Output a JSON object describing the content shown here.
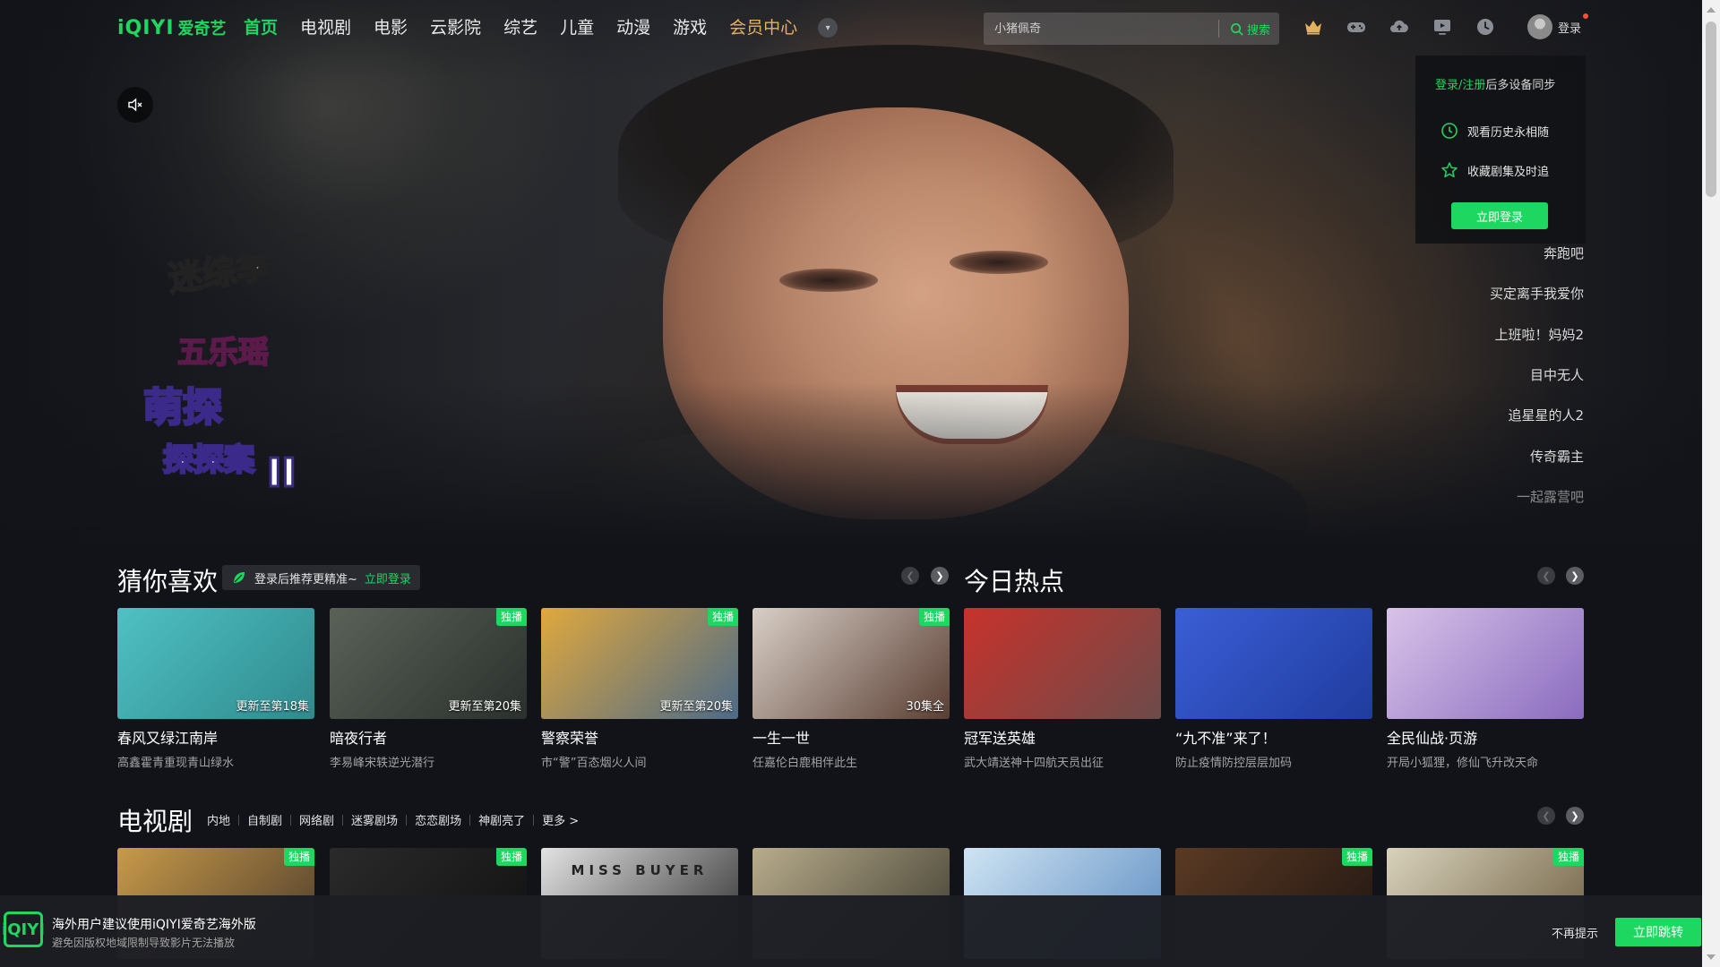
{
  "nav": {
    "logo_en": "iQIYI",
    "logo_cn": "爱奇艺",
    "links": [
      {
        "label": "首页",
        "state": "active"
      },
      {
        "label": "电视剧",
        "state": "normal"
      },
      {
        "label": "电影",
        "state": "normal"
      },
      {
        "label": "云影院",
        "state": "normal"
      },
      {
        "label": "综艺",
        "state": "normal"
      },
      {
        "label": "儿童",
        "state": "normal"
      },
      {
        "label": "动漫",
        "state": "normal"
      },
      {
        "label": "游戏",
        "state": "normal"
      },
      {
        "label": "会员中心",
        "state": "vip"
      }
    ],
    "more_icon": "chevron-down-icon",
    "search": {
      "placeholder": "小猪佩奇",
      "button": "搜索"
    },
    "icons": [
      "vip-crown-icon",
      "gamepad-icon",
      "cloud-upload-icon",
      "tv-play-icon",
      "clock-history-icon"
    ],
    "login": "登录"
  },
  "hero": {
    "show_logo_lines": [
      "迷综季",
      "五乐瑶",
      "萌探",
      "探探案",
      "II"
    ],
    "popup": {
      "sync_link": "登录/注册",
      "sync_text": "后多设备同步",
      "rows": [
        {
          "icon": "clock-icon",
          "text": "观看历史永相随"
        },
        {
          "icon": "star-icon",
          "text": "收藏剧集及时追"
        }
      ],
      "button": "立即登录"
    },
    "list": [
      "奔跑吧",
      "买定离手我爱你",
      "上班啦！妈妈2",
      "目中无人",
      "追星星的人2",
      "传奇霸主",
      "一起露营吧"
    ]
  },
  "recommend": {
    "title": "猜你喜欢",
    "tip": "登录后推荐更精准~",
    "tip_link": "立即登录",
    "cards": [
      {
        "title": "春风又绿江南岸",
        "sub": "高鑫霍青重现青山绿水",
        "badge": "",
        "ep": "更新至第18集",
        "colors": [
          "#4fc1c4",
          "#2f8a8d"
        ]
      },
      {
        "title": "暗夜行者",
        "sub": "李易峰宋轶逆光潜行",
        "badge": "独播",
        "ep": "更新至第20集",
        "colors": [
          "#5a6258",
          "#2a302c"
        ]
      },
      {
        "title": "警察荣誉",
        "sub": "市“警”百态烟火人间",
        "badge": "独播",
        "ep": "更新至第20集",
        "colors": [
          "#e0a83e",
          "#4c6a88"
        ]
      },
      {
        "title": "一生一世",
        "sub": "任嘉伦白鹿相伴此生",
        "badge": "独播",
        "ep": "30集全",
        "colors": [
          "#d8cfc6",
          "#5a3e33"
        ]
      }
    ]
  },
  "hot": {
    "title": "今日热点",
    "cards": [
      {
        "title": "冠军送英雄",
        "sub": "武大靖送神十四航天员出征",
        "badge": "",
        "ep": "",
        "colors": [
          "#c8322b",
          "#6c4b4a"
        ]
      },
      {
        "title": "“九不准”来了！",
        "sub": "防止疫情防控层层加码",
        "badge": "",
        "ep": "",
        "colors": [
          "#3b5ed6",
          "#1f3c9e"
        ]
      },
      {
        "title": "全民仙战·页游",
        "sub": "开局小狐狸，修仙飞升改天命",
        "badge": "",
        "ep": "",
        "colors": [
          "#d9c3e8",
          "#8a6bbf"
        ]
      }
    ]
  },
  "tv": {
    "title": "电视剧",
    "tabs": [
      "内地",
      "自制剧",
      "网络剧",
      "迷雾剧场",
      "恋恋剧场",
      "神剧亮了",
      "更多 >"
    ],
    "cards": [
      {
        "badge": "独播",
        "colors": [
          "#c89a4a",
          "#4a3a2a"
        ]
      },
      {
        "badge": "独播",
        "colors": [
          "#2a2a2a",
          "#101010"
        ]
      },
      {
        "badge": "",
        "title_on_poster": "MISS BUYER",
        "colors": [
          "#e2e2e2",
          "#2a2a2a"
        ]
      },
      {
        "badge": "",
        "colors": [
          "#b8ac8c",
          "#3c3a2e"
        ]
      },
      {
        "badge": "",
        "colors": [
          "#cfe4f3",
          "#5a8ac0"
        ]
      },
      {
        "badge": "独播",
        "colors": [
          "#5a3a24",
          "#1e1410"
        ]
      },
      {
        "badge": "独播",
        "colors": [
          "#d8d2bc",
          "#6a5a3c"
        ]
      }
    ]
  },
  "banner": {
    "logo": "iQIYI",
    "title": "海外用户建议使用iQIYI爱奇艺海外版",
    "sub": "避免因版权地域限制导致影片无法播放",
    "dismiss": "不再提示",
    "button": "立即跳转"
  },
  "colors": {
    "accent": "#1ed760",
    "vip": "#e6b15c",
    "bg": "#111319"
  }
}
